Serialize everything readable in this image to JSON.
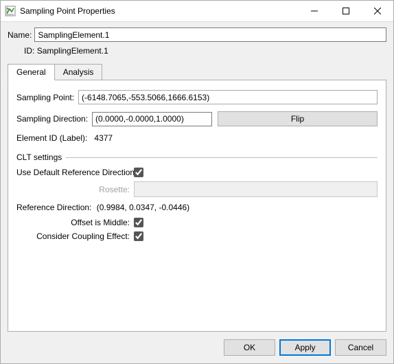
{
  "window": {
    "title": "Sampling Point Properties"
  },
  "header": {
    "name_label": "Name:",
    "name_value": "SamplingElement.1",
    "id_label": "ID:",
    "id_value": "SamplingElement.1"
  },
  "tabs": {
    "general": "General",
    "analysis": "Analysis"
  },
  "general": {
    "sampling_point_label": "Sampling Point:",
    "sampling_point_value": "(-6148.7065,-553.5066,1666.6153)",
    "sampling_direction_label": "Sampling Direction:",
    "sampling_direction_value": "(0.0000,-0.0000,1.0000)",
    "flip_label": "Flip",
    "element_id_label": "Element ID (Label):",
    "element_id_value": "4377",
    "clt_header": "CLT settings",
    "use_default_ref_label": "Use Default Reference Direction:",
    "use_default_ref_checked": true,
    "rosette_label": "Rosette:",
    "rosette_value": "",
    "reference_direction_label": "Reference Direction:",
    "reference_direction_value": "(0.9984, 0.0347, -0.0446)",
    "offset_is_middle_label": "Offset is Middle:",
    "offset_is_middle_checked": true,
    "consider_coupling_label": "Consider Coupling Effect:",
    "consider_coupling_checked": true
  },
  "footer": {
    "ok": "OK",
    "apply": "Apply",
    "cancel": "Cancel"
  }
}
